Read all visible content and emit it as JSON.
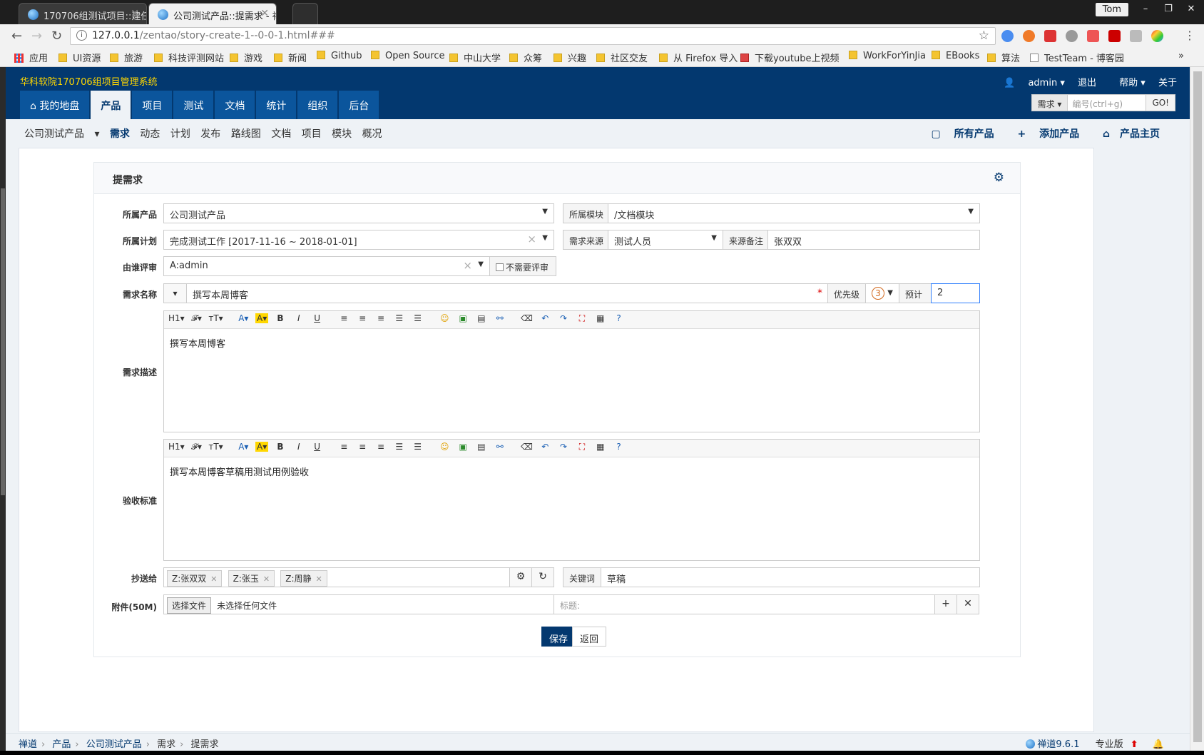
{
  "browser": {
    "tabs": [
      {
        "title": "170706组测试项目::建任"
      },
      {
        "title": "公司测试产品::提需求 - 禅"
      }
    ],
    "user": "Tom",
    "window_buttons": [
      "–",
      "❐",
      "✕"
    ],
    "url_host": "127.0.0.1",
    "url_path": "/zentao/story-create-1--0-0-1.html###",
    "bookmarks": [
      "应用",
      "UI资源",
      "旅游",
      "科技评测网站",
      "游戏",
      "新闻",
      "Github",
      "Open Source",
      "中山大学",
      "众筹",
      "兴趣",
      "社区交友",
      "从 Firefox 导入",
      "下载youtube上视频",
      "WorkForYinJia",
      "EBooks",
      "算法",
      "TestTeam - 博客园"
    ],
    "more": "»"
  },
  "header": {
    "site_name": "华科软院170706组项目管理系统",
    "user": "admin",
    "links": {
      "logout": "退出",
      "help": "帮助",
      "about": "关于"
    },
    "search": {
      "type": "需求",
      "placeholder": "编号(ctrl+g)",
      "go": "GO!"
    },
    "nav": [
      "我的地盘",
      "产品",
      "项目",
      "测试",
      "文档",
      "统计",
      "组织",
      "后台"
    ]
  },
  "subnav": {
    "product": "公司测试产品",
    "items": [
      "需求",
      "动态",
      "计划",
      "发布",
      "路线图",
      "文档",
      "项目",
      "模块",
      "概况"
    ],
    "right": [
      "所有产品",
      "添加产品",
      "产品主页"
    ]
  },
  "form": {
    "title": "提需求",
    "labels": {
      "product": "所属产品",
      "plan": "所属计划",
      "reviewer": "由谁评审",
      "name": "需求名称",
      "desc": "需求描述",
      "verify": "验收标准",
      "mailto": "抄送给",
      "files": "附件(50M)"
    },
    "product": "公司测试产品",
    "module_label": "所属模块",
    "module": "/文档模块",
    "plan": "完成测试工作 [2017-11-16 ~ 2018-01-01]",
    "source_label": "需求来源",
    "source": "测试人员",
    "source_note_label": "来源备注",
    "source_note": "张双双",
    "reviewer": "A:admin",
    "no_review": "不需要评审",
    "name": "撰写本周博客",
    "priority_label": "优先级",
    "priority": "3",
    "estimate_label": "预计",
    "estimate": "2",
    "toolbar": [
      "H1▾",
      "𝓕▾",
      "ᴛT▾",
      "A▾",
      "A▾",
      "B",
      "I",
      "U",
      "≡",
      "≡",
      "≡",
      "☰",
      "☰",
      "☺",
      "▣",
      "▤",
      "⚯",
      "⌫",
      "↶",
      "↷",
      "⛶",
      "▦",
      "?"
    ],
    "desc": "撰写本周博客",
    "verify": "撰写本周博客草稿用测试用例验收",
    "mailto": [
      "Z:张双双",
      "Z:张玉",
      "Z:周静"
    ],
    "keywords_label": "关键词",
    "keywords": "草稿",
    "choose_file": "选择文件",
    "no_file": "未选择任何文件",
    "file_title_placeholder": "标题:",
    "save": "保存",
    "back": "返回"
  },
  "footer": {
    "crumbs": [
      "禅道",
      "产品",
      "公司测试产品",
      "需求",
      "提需求"
    ],
    "version": "禅道9.6.1",
    "edition": "专业版"
  }
}
